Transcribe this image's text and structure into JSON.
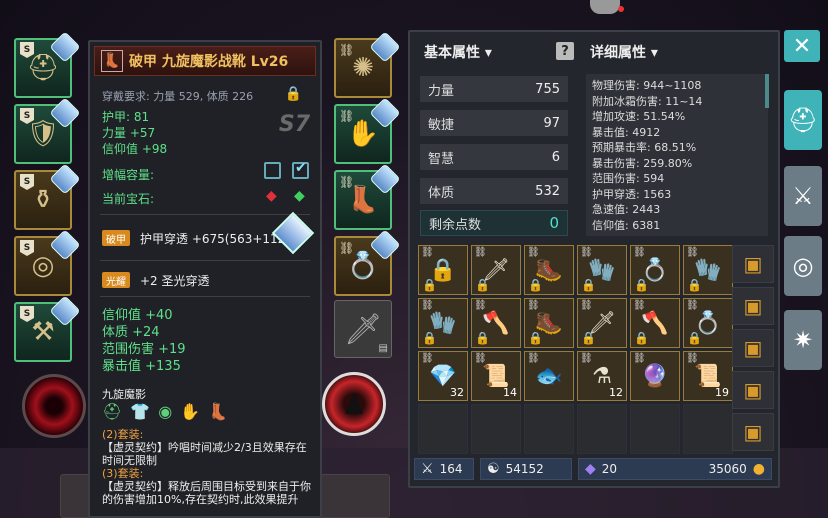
{
  "tooltip": {
    "title": "破甲 九旋魔影战靴 Lv26",
    "requirement": "穿戴要求: 力量 529, 体质 226",
    "grade": "S7",
    "stats": [
      "护甲: 81",
      "力量 +57",
      "信仰值 +98"
    ],
    "amplify_label": "增幅容量:",
    "gem_label": "当前宝石:",
    "affix1_tag": "破甲",
    "affix1_text": "护甲穿透 +675(563+112)",
    "affix2_tag": "光耀",
    "affix2_text": "+2 圣光穿透",
    "bonus": [
      "信仰值 +40",
      "体质 +24",
      "范围伤害 +19",
      "暴击值 +135"
    ],
    "set_name": "九旋魔影",
    "set_text": [
      {
        "cls": "orange",
        "text": "(2)套装:"
      },
      {
        "cls": "white",
        "text": "【虚灵契约】吟唱时间减少2/3且效果存在"
      },
      {
        "cls": "white",
        "text": "时间无限制"
      },
      {
        "cls": "orange",
        "text": "(3)套装:"
      },
      {
        "cls": "white",
        "text": "【虚灵契约】释放后周围目标受到来自于你"
      },
      {
        "cls": "white",
        "text": "的伤害增加10%,存在契约时,此效果提升"
      }
    ]
  },
  "panel": {
    "basic_title": "基本属性 ▾",
    "detail_title": "详细属性 ▾",
    "help": "?",
    "attrs": [
      {
        "label": "力量",
        "value": "755"
      },
      {
        "label": "敏捷",
        "value": "97"
      },
      {
        "label": "智慧",
        "value": "6"
      },
      {
        "label": "体质",
        "value": "532"
      }
    ],
    "points_label": "剩余点数",
    "points_value": "0",
    "details": [
      "物理伤害: 944~1108",
      "附加冰霜伤害: 11~14",
      "增加攻速: 51.54%",
      "暴击值: 4912",
      "预期暴击率: 68.51%",
      "暴击伤害: 259.80%",
      "范围伤害: 594",
      "护甲穿透: 1563",
      "急速值: 2443",
      "信仰值: 6381"
    ]
  },
  "inventory": [
    {
      "icon": "🔒",
      "lock": true,
      "count": ""
    },
    {
      "icon": "🗡",
      "lock": true,
      "count": ""
    },
    {
      "icon": "🥾",
      "lock": true,
      "count": ""
    },
    {
      "icon": "🧤",
      "lock": true,
      "count": ""
    },
    {
      "icon": "💍",
      "lock": true,
      "count": ""
    },
    {
      "icon": "🧤",
      "lock": true,
      "count": ""
    },
    {
      "icon": "🧤",
      "lock": true,
      "count": ""
    },
    {
      "icon": "🪓",
      "lock": true,
      "count": ""
    },
    {
      "icon": "🥾",
      "lock": true,
      "count": ""
    },
    {
      "icon": "🗡",
      "lock": true,
      "count": ""
    },
    {
      "icon": "🪓",
      "lock": true,
      "count": ""
    },
    {
      "icon": "💍",
      "lock": true,
      "count": ""
    },
    {
      "icon": "💎",
      "lock": false,
      "count": "32"
    },
    {
      "icon": "📜",
      "lock": false,
      "count": "14"
    },
    {
      "icon": "🐟",
      "lock": false,
      "count": ""
    },
    {
      "icon": "⚗",
      "lock": false,
      "count": "12"
    },
    {
      "icon": "🔮",
      "lock": false,
      "count": ""
    },
    {
      "icon": "📜",
      "lock": false,
      "count": "19"
    },
    {
      "icon": "",
      "lock": false,
      "count": ""
    },
    {
      "icon": "",
      "lock": false,
      "count": ""
    },
    {
      "icon": "",
      "lock": false,
      "count": ""
    },
    {
      "icon": "",
      "lock": false,
      "count": ""
    },
    {
      "icon": "",
      "lock": false,
      "count": ""
    },
    {
      "icon": "",
      "lock": false,
      "count": ""
    }
  ],
  "currency": {
    "c1": "164",
    "c2": "54152",
    "c3": "20",
    "gold": "35060"
  },
  "equipment": {
    "grade_letter": "S"
  }
}
